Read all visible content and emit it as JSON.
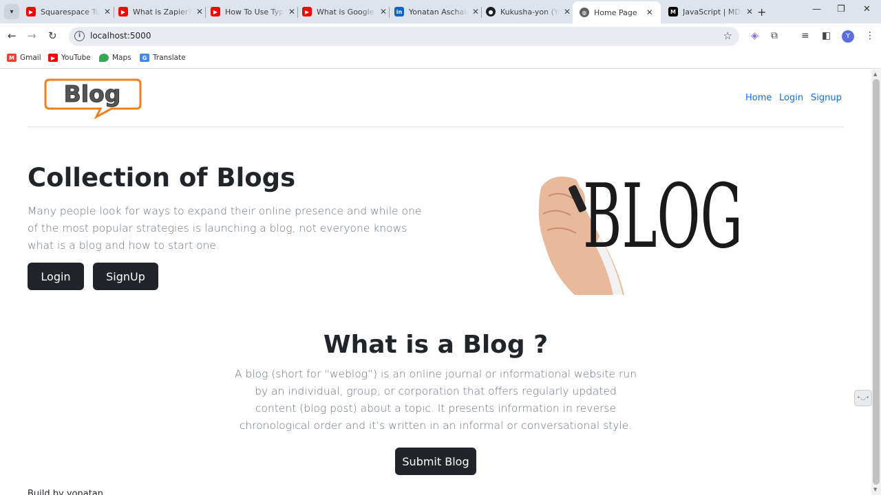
{
  "browser": {
    "tabs": [
      {
        "title": "Squarespace Tutorial",
        "favicon": "youtube-icon",
        "color": "#ff0000"
      },
      {
        "title": "What is Zapier? ",
        "favicon": "youtube-icon",
        "color": "#ff0000"
      },
      {
        "title": "How To Use Typeform",
        "favicon": "youtube-icon",
        "color": "#ff0000"
      },
      {
        "title": "What is Google Analytics",
        "favicon": "youtube-icon",
        "color": "#ff0000"
      },
      {
        "title": "Yonatan Aschalew",
        "favicon": "linkedin-icon",
        "color": "#0a66c2"
      },
      {
        "title": "Kukusha-yon (Yonatan)",
        "favicon": "github-icon",
        "color": "#1b1f23"
      },
      {
        "title": "Home Page",
        "favicon": "globe-icon",
        "color": "#5f6368",
        "active": true
      },
      {
        "title": "JavaScript | MDN",
        "favicon": "mdn-icon",
        "color": "#000000"
      }
    ],
    "url": "localhost:5000",
    "bookmarks": [
      {
        "label": "Gmail",
        "icon": "gmail-icon"
      },
      {
        "label": "YouTube",
        "icon": "youtube-icon"
      },
      {
        "label": "Maps",
        "icon": "maps-icon"
      },
      {
        "label": "Translate",
        "icon": "translate-icon"
      }
    ],
    "profile_initial": "Y"
  },
  "header": {
    "logo_text": "Blog",
    "nav": [
      "Home",
      "Login",
      "Signup"
    ]
  },
  "hero": {
    "title": "Collection of Blogs",
    "text": "Many people look for ways to expand their online presence and while one of the most popular strategies is launching a blog, not everyone knows what is a blog and how to start one.",
    "login_button": "Login",
    "signup_button": "SignUp",
    "image_text": "BLOG"
  },
  "about": {
    "title": "What is a Blog ?",
    "text": "A blog (short for “weblog”) is an online journal or informational website run by an individual, group, or corporation that offers regularly updated content (blog post) about a topic. It presents information in reverse chronological order and it’s written in an informal or conversational style.",
    "submit_button": "Submit Blog"
  },
  "footer": {
    "text": "Build by yonatan"
  },
  "colors": {
    "primary_link": "#0d6efd",
    "dark_button": "#212529",
    "logo_orange": "#f07f1a"
  }
}
